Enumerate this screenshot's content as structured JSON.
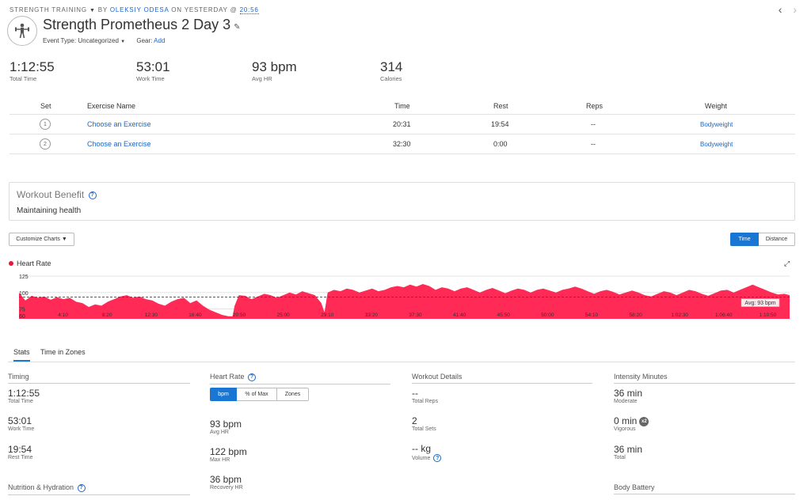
{
  "header": {
    "activity_type": "STRENGTH TRAINING",
    "by": "BY",
    "owner": "OLEKSIY ODESA",
    "on": "ON",
    "date": "YESTERDAY",
    "at": "@",
    "time": "20:56",
    "title": "Strength Prometheus 2 Day 3",
    "event_type_label": "Event Type:",
    "event_type_value": "Uncategorized",
    "gear_label": "Gear:",
    "gear_value": "Add",
    "prev_label": "‹",
    "next_label": "›"
  },
  "summary": [
    {
      "value": "1:12:55",
      "label": "Total Time"
    },
    {
      "value": "53:01",
      "label": "Work Time"
    },
    {
      "value": "93 bpm",
      "label": "Avg HR"
    },
    {
      "value": "314",
      "label": "Calories"
    }
  ],
  "sets_table": {
    "headers": {
      "set": "Set",
      "exercise": "Exercise Name",
      "time": "Time",
      "rest": "Rest",
      "reps": "Reps",
      "weight": "Weight"
    },
    "rows": [
      {
        "num": "1",
        "exercise": "Choose an Exercise",
        "time": "20:31",
        "rest": "19:54",
        "reps": "--",
        "weight": "Bodyweight"
      },
      {
        "num": "2",
        "exercise": "Choose an Exercise",
        "time": "32:30",
        "rest": "0:00",
        "reps": "--",
        "weight": "Bodyweight"
      }
    ]
  },
  "workout_benefit": {
    "title": "Workout Benefit",
    "value": "Maintaining health"
  },
  "chart_controls": {
    "customize": "Customize Charts",
    "time": "Time",
    "distance": "Distance"
  },
  "chart_data": {
    "type": "area",
    "series_name": "Heart Rate",
    "color": "#ff2a55",
    "avg_label": "Avg: 93 bpm",
    "avg": 93,
    "ylim": [
      60,
      125
    ],
    "y_ticks": [
      "125",
      "100",
      "75",
      "60"
    ],
    "x_ticks": [
      "4:10",
      "8:20",
      "12:30",
      "16:40",
      "20:50",
      "25:00",
      "29:10",
      "33:20",
      "37:30",
      "41:40",
      "45:50",
      "50:00",
      "54:10",
      "58:20",
      "1:02:30",
      "1:06:40",
      "1:10:50"
    ],
    "x_total_min": 72.9,
    "points": [
      [
        0,
        100
      ],
      [
        0.6,
        88
      ],
      [
        1.2,
        95
      ],
      [
        1.8,
        92
      ],
      [
        2.4,
        94
      ],
      [
        3,
        89
      ],
      [
        3.6,
        93
      ],
      [
        4.2,
        90
      ],
      [
        4.8,
        92
      ],
      [
        5.4,
        86
      ],
      [
        6,
        84
      ],
      [
        6.6,
        78
      ],
      [
        7.2,
        82
      ],
      [
        7.8,
        80
      ],
      [
        8.4,
        86
      ],
      [
        9,
        90
      ],
      [
        9.6,
        94
      ],
      [
        10.2,
        96
      ],
      [
        10.8,
        92
      ],
      [
        11.4,
        94
      ],
      [
        12,
        90
      ],
      [
        12.6,
        88
      ],
      [
        13.2,
        83
      ],
      [
        13.8,
        80
      ],
      [
        14.4,
        86
      ],
      [
        15,
        90
      ],
      [
        15.6,
        92
      ],
      [
        16.2,
        84
      ],
      [
        16.8,
        88
      ],
      [
        17.4,
        80
      ],
      [
        18,
        74
      ],
      [
        18.6,
        70
      ],
      [
        19.2,
        66
      ],
      [
        19.8,
        64
      ],
      [
        20.2,
        64
      ],
      [
        20.4,
        80
      ],
      [
        20.8,
        96
      ],
      [
        21.4,
        95
      ],
      [
        22,
        90
      ],
      [
        22.6,
        94
      ],
      [
        23.2,
        98
      ],
      [
        23.8,
        96
      ],
      [
        24.4,
        92
      ],
      [
        25,
        96
      ],
      [
        25.6,
        100
      ],
      [
        26.2,
        97
      ],
      [
        26.8,
        102
      ],
      [
        27.4,
        99
      ],
      [
        28,
        96
      ],
      [
        28.6,
        84
      ],
      [
        28.9,
        70
      ],
      [
        29.2,
        100
      ],
      [
        29.8,
        104
      ],
      [
        30.4,
        102
      ],
      [
        31,
        106
      ],
      [
        31.6,
        104
      ],
      [
        32.2,
        100
      ],
      [
        32.8,
        103
      ],
      [
        33.4,
        106
      ],
      [
        34,
        102
      ],
      [
        34.6,
        104
      ],
      [
        35.2,
        108
      ],
      [
        35.8,
        110
      ],
      [
        36.4,
        108
      ],
      [
        37,
        112
      ],
      [
        37.6,
        109
      ],
      [
        38.2,
        113
      ],
      [
        38.8,
        110
      ],
      [
        39.4,
        104
      ],
      [
        40,
        108
      ],
      [
        40.6,
        106
      ],
      [
        41.2,
        102
      ],
      [
        41.8,
        106
      ],
      [
        42.4,
        108
      ],
      [
        43,
        104
      ],
      [
        43.6,
        100
      ],
      [
        44.2,
        104
      ],
      [
        44.8,
        107
      ],
      [
        45.4,
        103
      ],
      [
        46,
        99
      ],
      [
        46.6,
        103
      ],
      [
        47.2,
        106
      ],
      [
        47.8,
        104
      ],
      [
        48.4,
        100
      ],
      [
        49,
        104
      ],
      [
        49.6,
        106
      ],
      [
        50.2,
        103
      ],
      [
        50.8,
        100
      ],
      [
        51.4,
        104
      ],
      [
        52,
        106
      ],
      [
        52.6,
        109
      ],
      [
        53.2,
        106
      ],
      [
        53.8,
        102
      ],
      [
        54.4,
        98
      ],
      [
        55,
        102
      ],
      [
        55.6,
        104
      ],
      [
        56.2,
        101
      ],
      [
        56.8,
        97
      ],
      [
        57.4,
        100
      ],
      [
        58,
        103
      ],
      [
        58.6,
        100
      ],
      [
        59.2,
        96
      ],
      [
        59.8,
        94
      ],
      [
        60.4,
        98
      ],
      [
        61,
        102
      ],
      [
        61.6,
        100
      ],
      [
        62.2,
        96
      ],
      [
        62.8,
        100
      ],
      [
        63.4,
        104
      ],
      [
        64,
        102
      ],
      [
        64.6,
        98
      ],
      [
        65.2,
        95
      ],
      [
        65.8,
        99
      ],
      [
        66.4,
        103
      ],
      [
        67,
        104
      ],
      [
        67.6,
        100
      ],
      [
        68.2,
        104
      ],
      [
        68.8,
        108
      ],
      [
        69.4,
        112
      ],
      [
        70,
        108
      ],
      [
        70.6,
        104
      ],
      [
        71.2,
        100
      ],
      [
        71.8,
        97
      ],
      [
        72.4,
        98
      ],
      [
        72.9,
        96
      ]
    ]
  },
  "tabs": [
    {
      "label": "Stats"
    },
    {
      "label": "Time in Zones"
    }
  ],
  "stats": {
    "timing": {
      "title": "Timing",
      "items": [
        {
          "value": "1:12:55",
          "label": "Total Time"
        },
        {
          "value": "53:01",
          "label": "Work Time"
        },
        {
          "value": "19:54",
          "label": "Rest Time"
        }
      ]
    },
    "heart_rate": {
      "title": "Heart Rate",
      "modes": [
        "bpm",
        "% of Max",
        "Zones"
      ],
      "items": [
        {
          "value": "93 bpm",
          "label": "Avg HR"
        },
        {
          "value": "122 bpm",
          "label": "Max HR"
        },
        {
          "value": "36 bpm",
          "label": "Recovery HR"
        }
      ]
    },
    "workout_details": {
      "title": "Workout Details",
      "items": [
        {
          "value": "--",
          "label": "Total Reps"
        },
        {
          "value": "2",
          "label": "Total Sets"
        },
        {
          "value": "-- kg",
          "label": "Volume"
        }
      ]
    },
    "intensity": {
      "title": "Intensity Minutes",
      "x2": "x2",
      "items": [
        {
          "value": "36 min",
          "label": "Moderate"
        },
        {
          "value": "0 min",
          "label": "Vigorous"
        },
        {
          "value": "36 min",
          "label": "Total"
        }
      ]
    },
    "nutrition": {
      "title": "Nutrition & Hydration"
    },
    "body_battery": {
      "title": "Body Battery"
    }
  }
}
